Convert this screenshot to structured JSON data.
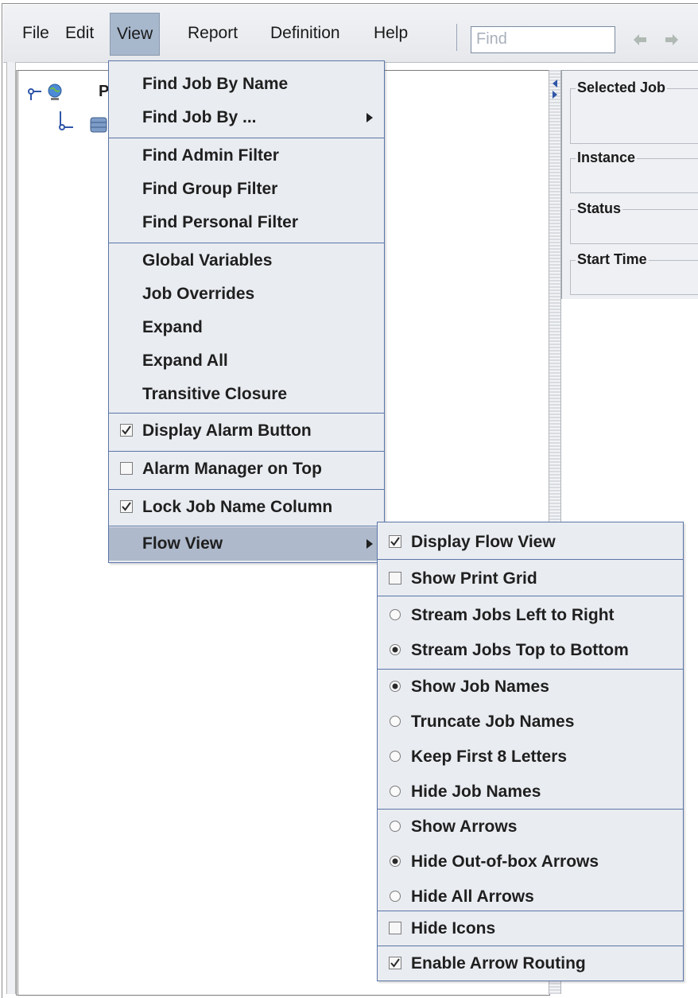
{
  "menubar": {
    "items": [
      {
        "label": "File"
      },
      {
        "label": "Edit"
      },
      {
        "label": "View"
      },
      {
        "label": "Report"
      },
      {
        "label": "Definition"
      },
      {
        "label": "Help"
      }
    ],
    "find_placeholder": "Find"
  },
  "tree": {
    "root_label": "P"
  },
  "details": {
    "fields": [
      "Selected Job",
      "Instance",
      "Status",
      "Start Time"
    ]
  },
  "view_menu": {
    "items": [
      {
        "label": "Find Job By Name"
      },
      {
        "label": "Find Job By ..."
      },
      {
        "label": "Find Admin Filter"
      },
      {
        "label": "Find Group Filter"
      },
      {
        "label": "Find Personal Filter"
      },
      {
        "label": "Global Variables"
      },
      {
        "label": "Job Overrides"
      },
      {
        "label": "Expand"
      },
      {
        "label": "Expand All"
      },
      {
        "label": "Transitive Closure"
      },
      {
        "label": "Display Alarm Button",
        "checked": true
      },
      {
        "label": "Alarm Manager on Top",
        "checked": false
      },
      {
        "label": "Lock Job Name Column",
        "checked": true
      },
      {
        "label": "Flow View"
      }
    ]
  },
  "flow_view_menu": {
    "items": [
      {
        "label": "Display Flow View",
        "checked": true
      },
      {
        "label": "Show Print Grid",
        "checked": false
      },
      {
        "label": "Stream Jobs Left to Right",
        "selected": false
      },
      {
        "label": "Stream Jobs Top to Bottom",
        "selected": true
      },
      {
        "label": "Show Job Names",
        "selected": true
      },
      {
        "label": "Truncate Job Names",
        "selected": false
      },
      {
        "label": "Keep First 8 Letters",
        "selected": false
      },
      {
        "label": "Hide Job Names",
        "selected": false
      },
      {
        "label": "Show Arrows",
        "selected": false
      },
      {
        "label": "Hide Out-of-box Arrows",
        "selected": true
      },
      {
        "label": "Hide All Arrows",
        "selected": false
      },
      {
        "label": "Hide Icons",
        "checked": false
      },
      {
        "label": "Enable Arrow Routing",
        "checked": true
      }
    ]
  },
  "colors": {
    "menu_bg": "#e9ecf1",
    "menu_border": "#5b76a8",
    "highlight": "#aeb9cb"
  }
}
